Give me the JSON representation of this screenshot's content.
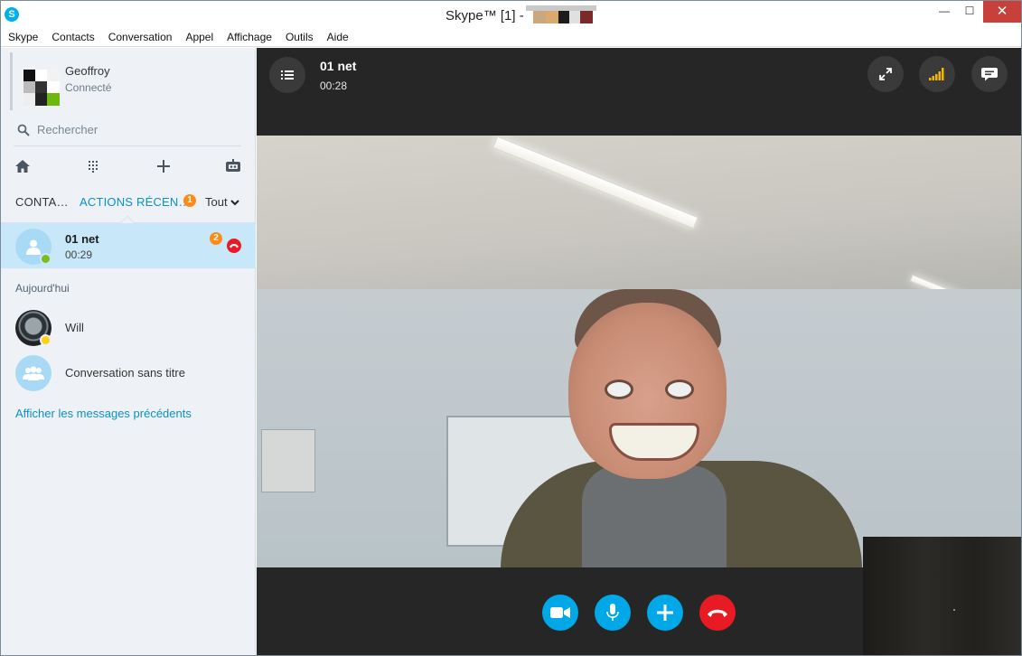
{
  "window": {
    "title": "Skype™ [1] -",
    "controls": {
      "minimize": "—",
      "maximize": "☐",
      "close": "✕"
    }
  },
  "menu": [
    "Skype",
    "Contacts",
    "Conversation",
    "Appel",
    "Affichage",
    "Outils",
    "Aide"
  ],
  "profile": {
    "name": "Geoffroy",
    "status": "Connecté"
  },
  "search": {
    "placeholder": "Rechercher"
  },
  "tabs": {
    "contacts": "CONTA…",
    "recent": "ACTIONS RÉCEN…",
    "recent_badge": "1",
    "filter": "Tout"
  },
  "recent": {
    "active": {
      "name": "01 net",
      "time": "00:29",
      "badge": "2"
    },
    "section_today": "Aujourd'hui",
    "items": [
      {
        "name": "Will"
      },
      {
        "name": "Conversation sans titre"
      }
    ],
    "show_previous": "Afficher les messages précédents"
  },
  "call": {
    "name": "01 net",
    "duration": "00:28"
  },
  "colors": {
    "accent": "#00a8e8",
    "hangup": "#e81b25",
    "badge": "#ff8b17",
    "online": "#7cbd1a",
    "away": "#fcd116",
    "link": "#0a8fd0"
  },
  "icons": {
    "toolbar": [
      "home-icon",
      "dialpad-icon",
      "plus-icon",
      "bot-icon"
    ],
    "call_top": [
      "list-menu-icon",
      "fullscreen-icon",
      "signal-icon",
      "chat-bubble-icon"
    ],
    "call_controls": [
      "video-camera-icon",
      "microphone-icon",
      "plus-icon",
      "hang-up-icon"
    ]
  }
}
